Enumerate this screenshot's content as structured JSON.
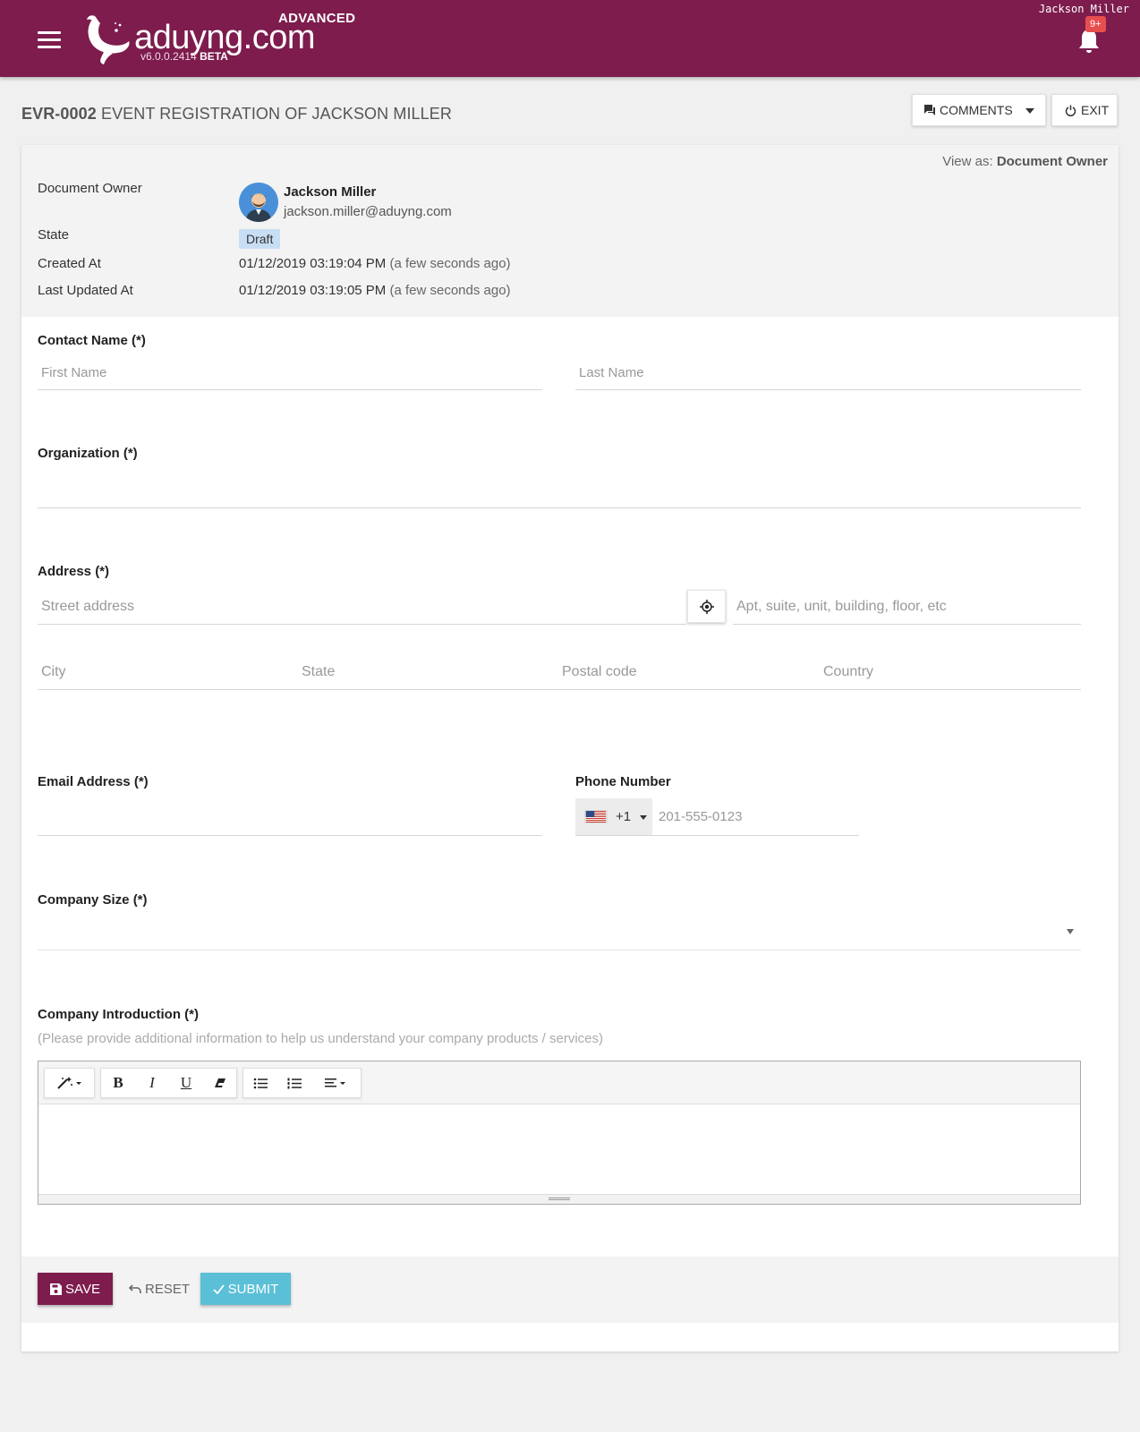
{
  "header": {
    "logo_text": "aduyng.com",
    "edition": "ADVANCED",
    "version": "v6.0.0.2414",
    "channel": "BETA",
    "user_name": "Jackson Miller",
    "notification_count": "9+",
    "brand_color": "#7d1c4d"
  },
  "page": {
    "doc_id": "EVR-0002",
    "title": "EVENT REGISTRATION OF JACKSON MILLER",
    "comments_label": "COMMENTS",
    "exit_label": "EXIT"
  },
  "meta": {
    "view_as_label": "View as:",
    "view_as_value": "Document Owner",
    "owner_label": "Document Owner",
    "owner_name": "Jackson Miller",
    "owner_email": "jackson.miller@aduyng.com",
    "state_label": "State",
    "state_value": "Draft",
    "created_label": "Created At",
    "created_value": "01/12/2019 03:19:04 PM",
    "created_ago": "(a few seconds ago)",
    "updated_label": "Last Updated At",
    "updated_value": "01/12/2019 03:19:05 PM",
    "updated_ago": "(a few seconds ago)"
  },
  "form": {
    "contact_label": "Contact Name (*)",
    "first_name_placeholder": "First Name",
    "last_name_placeholder": "Last Name",
    "organization_label": "Organization (*)",
    "address_label": "Address (*)",
    "street_placeholder": "Street address",
    "apt_placeholder": "Apt, suite, unit, building, floor, etc",
    "city_placeholder": "City",
    "state_placeholder": "State",
    "postal_placeholder": "Postal code",
    "country_placeholder": "Country",
    "email_label": "Email Address (*)",
    "phone_label": "Phone Number",
    "phone_dial_code": "+1",
    "phone_placeholder": "201-555-0123",
    "company_size_label": "Company Size (*)",
    "intro_label": "Company Introduction (*)",
    "intro_hint": "(Please provide additional information to help us understand your company products / services)"
  },
  "editor": {
    "toolbar": [
      "magic-icon",
      "bold-icon",
      "italic-icon",
      "underline-icon",
      "eraser-icon",
      "unordered-list-icon",
      "ordered-list-icon",
      "align-icon"
    ]
  },
  "actions": {
    "save_label": "SAVE",
    "reset_label": "RESET",
    "submit_label": "SUBMIT",
    "save_color": "#7d1c4d",
    "submit_color": "#5bbfd7"
  }
}
